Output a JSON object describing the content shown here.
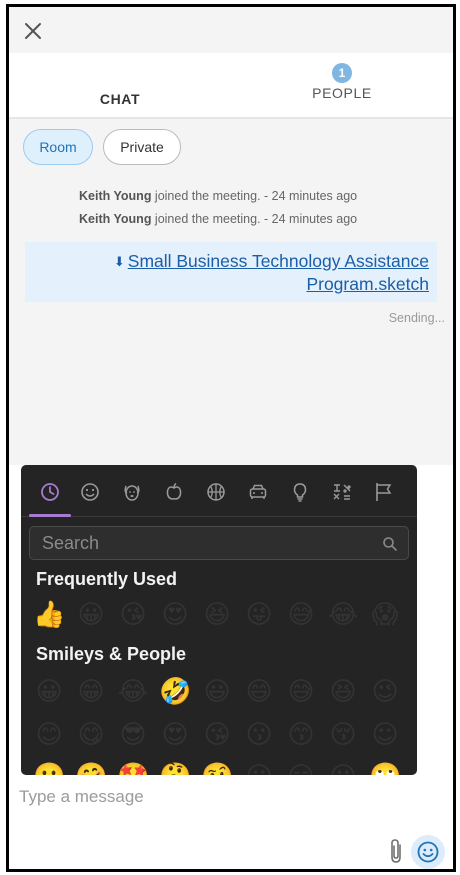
{
  "header": {
    "close_icon": "close-icon"
  },
  "tabs": {
    "chat": {
      "label": "CHAT",
      "active": true
    },
    "people": {
      "label": "PEOPLE",
      "badge": "1"
    },
    "accent_color": "#e8a33d"
  },
  "subtabs": {
    "room": {
      "label": "Room",
      "active": true
    },
    "private": {
      "label": "Private"
    }
  },
  "messages": {
    "system": [
      {
        "name": "Keith Young",
        "text": " joined the meeting. - 24 minutes ago"
      },
      {
        "name": "Keith Young",
        "text": " joined the meeting. - 24 minutes ago"
      }
    ],
    "file": {
      "line1": "Small Business Technology Assistance",
      "line2": "Program.sketch",
      "icon": "download-icon",
      "status": "Sending..."
    }
  },
  "emoji_picker": {
    "categories": [
      "recent-icon",
      "smiley-icon",
      "animal-icon",
      "food-icon",
      "sports-icon",
      "travel-icon",
      "objects-icon",
      "symbols-icon",
      "flags-icon"
    ],
    "active_category": "recent-icon",
    "search_placeholder": "Search",
    "sections": [
      {
        "title": "Frequently Used"
      },
      {
        "title": "Smileys & People"
      }
    ],
    "frequently_used": [
      "👍",
      "😀",
      "😘",
      "😍",
      "😆",
      "😜",
      "😅",
      "😂",
      "😱"
    ],
    "smileys_rows": [
      [
        "😀",
        "😁",
        "😂",
        "🤣",
        "😃",
        "😄",
        "😅",
        "😆",
        "😉"
      ],
      [
        "😊",
        "😋",
        "😎",
        "😍",
        "😘",
        "😗",
        "😙",
        "😚",
        "☺"
      ],
      [
        "🙂",
        "🤗",
        "🤩",
        "🤔",
        "🤨",
        "😐",
        "😑",
        "😶",
        "🙄"
      ]
    ]
  },
  "composer": {
    "placeholder": "Type a message",
    "attach_icon": "paperclip-icon",
    "emoji_button_icon": "smiley-icon"
  }
}
